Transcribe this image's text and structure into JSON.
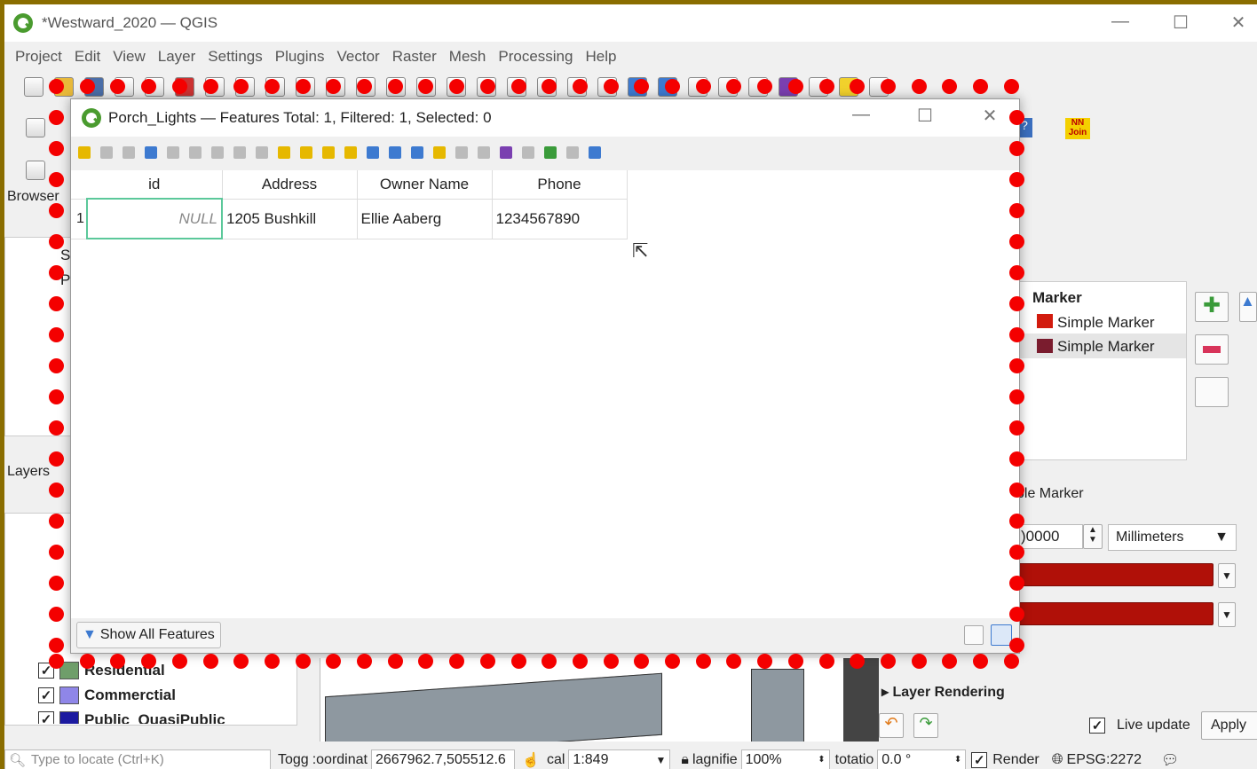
{
  "window": {
    "title": "*Westward_2020 — QGIS"
  },
  "menu": [
    "Project",
    "Edit",
    "View",
    "Layer",
    "Settings",
    "Plugins",
    "Vector",
    "Raster",
    "Mesh",
    "Processing",
    "Help"
  ],
  "browser": {
    "title": "Browser",
    "items": [
      "S",
      "P"
    ]
  },
  "layers": {
    "title": "Layers",
    "items": [
      {
        "label": "Residential",
        "color": "#6f9e6a"
      },
      {
        "label": "Commerctial",
        "color": "#8f86e8"
      },
      {
        "label": "Public_QuasiPublic",
        "color": "#1c1aa0"
      }
    ]
  },
  "attr_dialog": {
    "title": "Porch_Lights — Features Total: 1, Filtered: 1, Selected: 0",
    "columns": [
      "id",
      "Address",
      "Owner Name",
      "Phone"
    ],
    "rows": [
      {
        "num": "1",
        "id": "NULL",
        "address": "1205 Bushkill",
        "owner": "Ellie Aaberg",
        "phone": "1234567890"
      }
    ],
    "filter_button": "Show All Features"
  },
  "styling": {
    "marker_root": "Marker",
    "symbol_layers": [
      "Simple Marker",
      "Simple Marker"
    ],
    "symbol_type": "ple Marker",
    "size_value": ")0000",
    "unit": "Millimeters",
    "fill_color": "#b01008",
    "layer_rendering": "Layer Rendering",
    "live_update": "Live update",
    "apply": "Apply"
  },
  "nnjoin": {
    "line1": "NN",
    "line2": "Join"
  },
  "statusbar": {
    "locate_placeholder": "Type to locate (Ctrl+K)",
    "toggle": "Togg",
    "coord_label": ":oordinat",
    "coordinate": "2667962.7,505512.6",
    "scale_label": "cal",
    "scale": "1:849",
    "magnifier_label": "lagnifie",
    "magnifier": "100%",
    "rotation_label": "totatio",
    "rotation": "0.0 °",
    "render": "Render",
    "crs": "EPSG:2272"
  },
  "colors": {
    "accent_green": "#4a9b2f",
    "marker_red": "#f40000"
  }
}
